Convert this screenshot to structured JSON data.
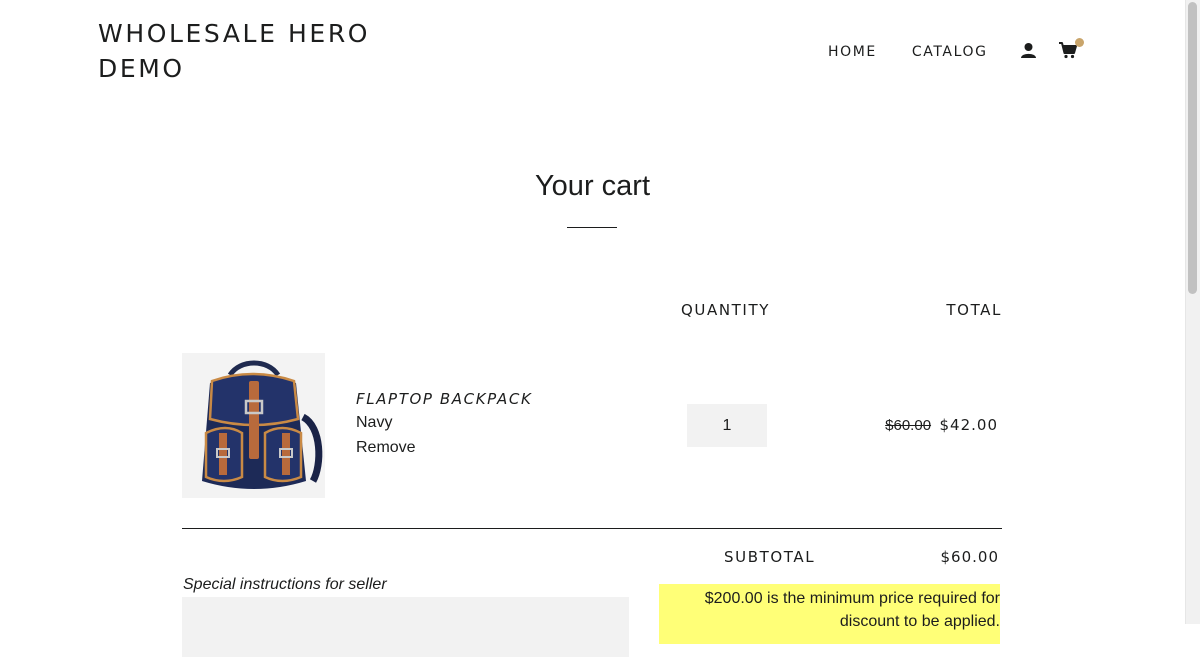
{
  "header": {
    "site_title": "WHOLESALE HERO DEMO",
    "nav": {
      "home": "HOME",
      "catalog": "CATALOG"
    },
    "icons": {
      "account": "account-icon",
      "cart": "cart-icon"
    },
    "cart_dot_color": "#c9a56b"
  },
  "cart": {
    "title": "Your cart",
    "columns": {
      "quantity": "QUANTITY",
      "total": "TOTAL"
    },
    "items": [
      {
        "name": "FLAPTOP BACKPACK",
        "variant": "Navy",
        "remove_label": "Remove",
        "quantity": "1",
        "original_price": "$60.00",
        "discounted_price": "$42.00",
        "image": "navy-backpack-image"
      }
    ],
    "subtotal_label": "SUBTOTAL",
    "subtotal_value": "$60.00",
    "notes_label": "Special instructions for seller",
    "notes_value": "",
    "discount_notice": "$200.00 is the minimum price required for discount to be applied."
  },
  "colors": {
    "text": "#1c1d1d",
    "notice_background": "#ffff77",
    "input_background": "#f2f2f2"
  }
}
